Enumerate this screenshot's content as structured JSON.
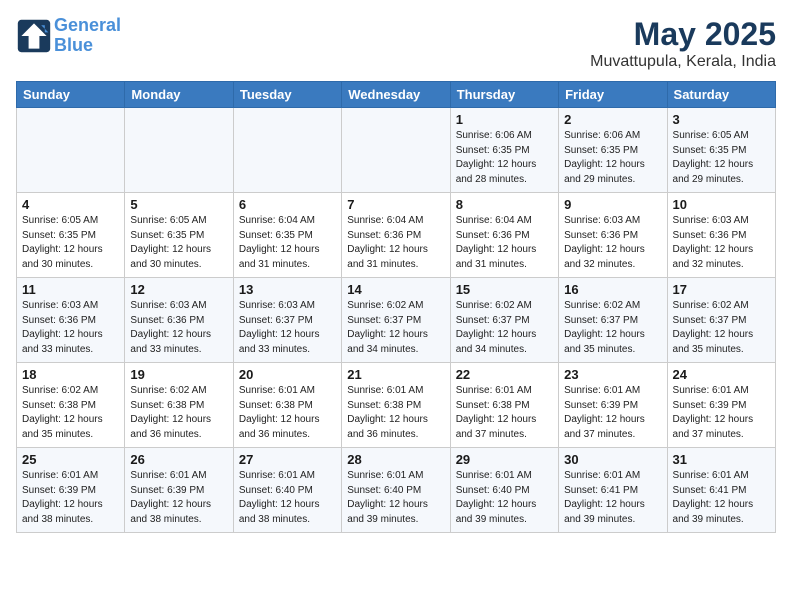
{
  "header": {
    "logo_line1": "General",
    "logo_line2": "Blue",
    "month": "May 2025",
    "location": "Muvattupula, Kerala, India"
  },
  "weekdays": [
    "Sunday",
    "Monday",
    "Tuesday",
    "Wednesday",
    "Thursday",
    "Friday",
    "Saturday"
  ],
  "weeks": [
    [
      {
        "day": "",
        "info": ""
      },
      {
        "day": "",
        "info": ""
      },
      {
        "day": "",
        "info": ""
      },
      {
        "day": "",
        "info": ""
      },
      {
        "day": "1",
        "info": "Sunrise: 6:06 AM\nSunset: 6:35 PM\nDaylight: 12 hours\nand 28 minutes."
      },
      {
        "day": "2",
        "info": "Sunrise: 6:06 AM\nSunset: 6:35 PM\nDaylight: 12 hours\nand 29 minutes."
      },
      {
        "day": "3",
        "info": "Sunrise: 6:05 AM\nSunset: 6:35 PM\nDaylight: 12 hours\nand 29 minutes."
      }
    ],
    [
      {
        "day": "4",
        "info": "Sunrise: 6:05 AM\nSunset: 6:35 PM\nDaylight: 12 hours\nand 30 minutes."
      },
      {
        "day": "5",
        "info": "Sunrise: 6:05 AM\nSunset: 6:35 PM\nDaylight: 12 hours\nand 30 minutes."
      },
      {
        "day": "6",
        "info": "Sunrise: 6:04 AM\nSunset: 6:35 PM\nDaylight: 12 hours\nand 31 minutes."
      },
      {
        "day": "7",
        "info": "Sunrise: 6:04 AM\nSunset: 6:36 PM\nDaylight: 12 hours\nand 31 minutes."
      },
      {
        "day": "8",
        "info": "Sunrise: 6:04 AM\nSunset: 6:36 PM\nDaylight: 12 hours\nand 31 minutes."
      },
      {
        "day": "9",
        "info": "Sunrise: 6:03 AM\nSunset: 6:36 PM\nDaylight: 12 hours\nand 32 minutes."
      },
      {
        "day": "10",
        "info": "Sunrise: 6:03 AM\nSunset: 6:36 PM\nDaylight: 12 hours\nand 32 minutes."
      }
    ],
    [
      {
        "day": "11",
        "info": "Sunrise: 6:03 AM\nSunset: 6:36 PM\nDaylight: 12 hours\nand 33 minutes."
      },
      {
        "day": "12",
        "info": "Sunrise: 6:03 AM\nSunset: 6:36 PM\nDaylight: 12 hours\nand 33 minutes."
      },
      {
        "day": "13",
        "info": "Sunrise: 6:03 AM\nSunset: 6:37 PM\nDaylight: 12 hours\nand 33 minutes."
      },
      {
        "day": "14",
        "info": "Sunrise: 6:02 AM\nSunset: 6:37 PM\nDaylight: 12 hours\nand 34 minutes."
      },
      {
        "day": "15",
        "info": "Sunrise: 6:02 AM\nSunset: 6:37 PM\nDaylight: 12 hours\nand 34 minutes."
      },
      {
        "day": "16",
        "info": "Sunrise: 6:02 AM\nSunset: 6:37 PM\nDaylight: 12 hours\nand 35 minutes."
      },
      {
        "day": "17",
        "info": "Sunrise: 6:02 AM\nSunset: 6:37 PM\nDaylight: 12 hours\nand 35 minutes."
      }
    ],
    [
      {
        "day": "18",
        "info": "Sunrise: 6:02 AM\nSunset: 6:38 PM\nDaylight: 12 hours\nand 35 minutes."
      },
      {
        "day": "19",
        "info": "Sunrise: 6:02 AM\nSunset: 6:38 PM\nDaylight: 12 hours\nand 36 minutes."
      },
      {
        "day": "20",
        "info": "Sunrise: 6:01 AM\nSunset: 6:38 PM\nDaylight: 12 hours\nand 36 minutes."
      },
      {
        "day": "21",
        "info": "Sunrise: 6:01 AM\nSunset: 6:38 PM\nDaylight: 12 hours\nand 36 minutes."
      },
      {
        "day": "22",
        "info": "Sunrise: 6:01 AM\nSunset: 6:38 PM\nDaylight: 12 hours\nand 37 minutes."
      },
      {
        "day": "23",
        "info": "Sunrise: 6:01 AM\nSunset: 6:39 PM\nDaylight: 12 hours\nand 37 minutes."
      },
      {
        "day": "24",
        "info": "Sunrise: 6:01 AM\nSunset: 6:39 PM\nDaylight: 12 hours\nand 37 minutes."
      }
    ],
    [
      {
        "day": "25",
        "info": "Sunrise: 6:01 AM\nSunset: 6:39 PM\nDaylight: 12 hours\nand 38 minutes."
      },
      {
        "day": "26",
        "info": "Sunrise: 6:01 AM\nSunset: 6:39 PM\nDaylight: 12 hours\nand 38 minutes."
      },
      {
        "day": "27",
        "info": "Sunrise: 6:01 AM\nSunset: 6:40 PM\nDaylight: 12 hours\nand 38 minutes."
      },
      {
        "day": "28",
        "info": "Sunrise: 6:01 AM\nSunset: 6:40 PM\nDaylight: 12 hours\nand 39 minutes."
      },
      {
        "day": "29",
        "info": "Sunrise: 6:01 AM\nSunset: 6:40 PM\nDaylight: 12 hours\nand 39 minutes."
      },
      {
        "day": "30",
        "info": "Sunrise: 6:01 AM\nSunset: 6:41 PM\nDaylight: 12 hours\nand 39 minutes."
      },
      {
        "day": "31",
        "info": "Sunrise: 6:01 AM\nSunset: 6:41 PM\nDaylight: 12 hours\nand 39 minutes."
      }
    ]
  ]
}
